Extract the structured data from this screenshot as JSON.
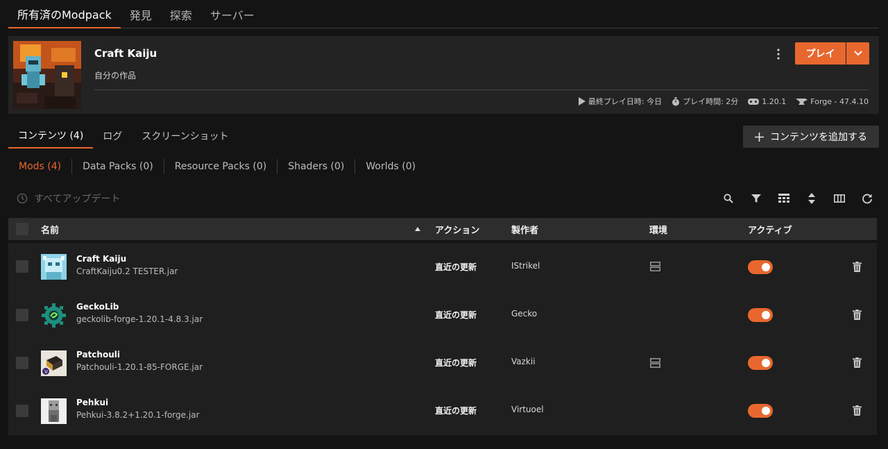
{
  "top_tabs": [
    "所有済のModpack",
    "発見",
    "探索",
    "サーバー"
  ],
  "pack": {
    "name": "Craft Kaiju",
    "author": "自分の作品",
    "last_played": "最終プレイ日時: 今日",
    "play_time": "プレイ時間: 2分",
    "game_version": "1.20.1",
    "loader": "Forge - 47.4.10",
    "play_label": "プレイ"
  },
  "content_tabs": [
    "コンテンツ (4)",
    "ログ",
    "スクリーンショット"
  ],
  "add_content_label": "コンテンツを追加する",
  "sub_tabs": [
    "Mods (4)",
    "Data Packs (0)",
    "Resource Packs (0)",
    "Shaders (0)",
    "Worlds (0)"
  ],
  "update_all_label": "すべてアップデート",
  "table": {
    "headers": {
      "name": "名前",
      "action": "アクション",
      "author": "製作者",
      "env": "環境",
      "active": "アクティブ"
    },
    "rows": [
      {
        "name": "Craft Kaiju",
        "file": "CraftKaiju0.2 TESTER.jar",
        "action": "直近の更新",
        "author": "IStrikel",
        "env_icon": "server-icon",
        "active": true
      },
      {
        "name": "GeckoLib",
        "file": "geckolib-forge-1.20.1-4.8.3.jar",
        "action": "直近の更新",
        "author": "Gecko",
        "env_icon": "",
        "active": true
      },
      {
        "name": "Patchouli",
        "file": "Patchouli-1.20.1-85-FORGE.jar",
        "action": "直近の更新",
        "author": "Vazkii",
        "env_icon": "server-icon",
        "active": true
      },
      {
        "name": "Pehkui",
        "file": "Pehkui-3.8.2+1.20.1-forge.jar",
        "action": "直近の更新",
        "author": "Virtuoel",
        "env_icon": "",
        "active": true
      }
    ]
  },
  "colors": {
    "accent": "#e8672e",
    "background": "#141414",
    "card": "#232323"
  }
}
